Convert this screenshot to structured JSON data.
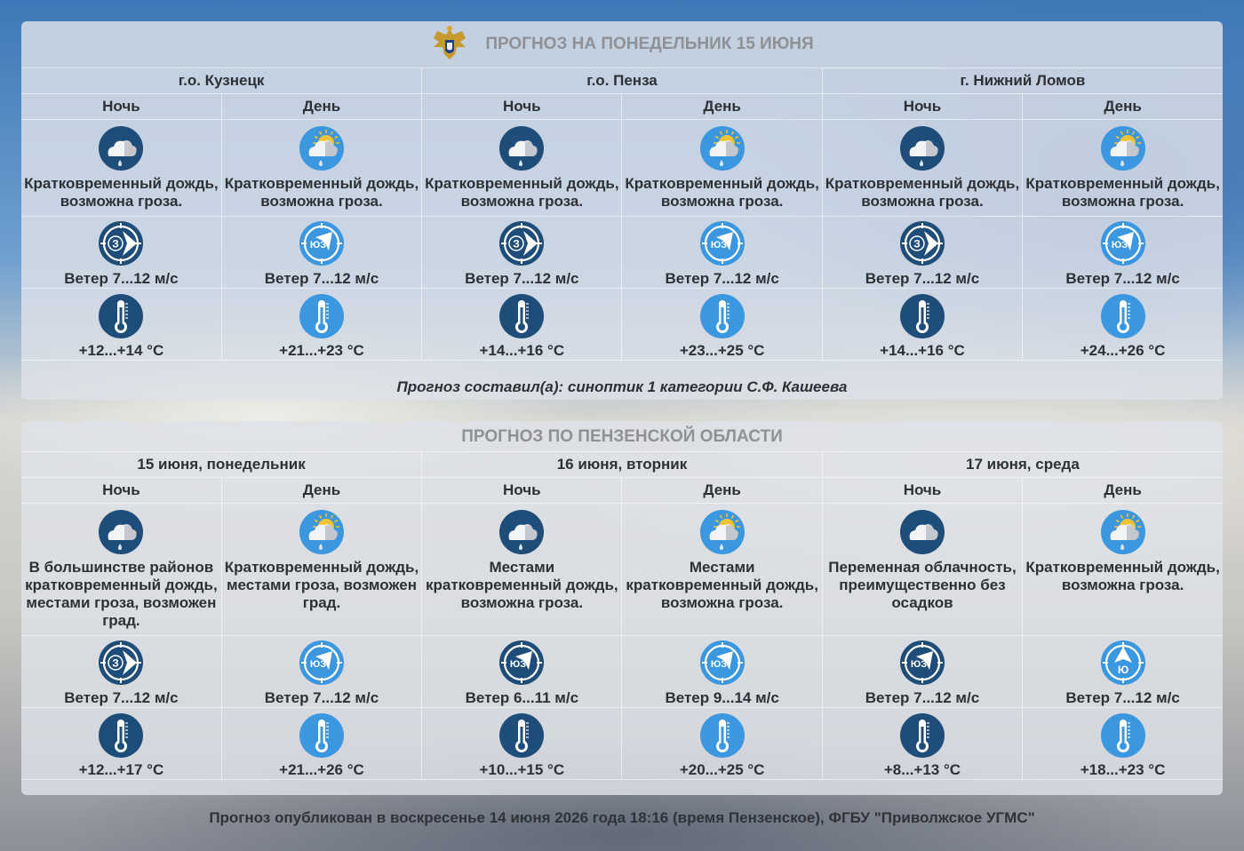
{
  "panel1": {
    "title": "ПРОГНОЗ НА ПОНЕДЕЛЬНИК 15 ИЮНЯ",
    "locations": [
      {
        "name": "г.о. Кузнецк",
        "periods": [
          {
            "label": "Ночь",
            "sky": "night-rain",
            "desc": "Кратковременный дождь, возможна гроза.",
            "wind_dir": "З",
            "wind": "Ветер 7...12 м/с",
            "temp": "+12...+14 °C",
            "temp_style": "night"
          },
          {
            "label": "День",
            "sky": "day-rain",
            "desc": "Кратковременный дождь, возможна гроза.",
            "wind_dir": "ЮЗ",
            "wind": "Ветер 7...12 м/с",
            "temp": "+21...+23 °C",
            "temp_style": "day"
          }
        ]
      },
      {
        "name": "г.о. Пенза",
        "periods": [
          {
            "label": "Ночь",
            "sky": "night-rain",
            "desc": "Кратковременный дождь, возможна гроза.",
            "wind_dir": "З",
            "wind": "Ветер 7...12 м/с",
            "temp": "+14...+16 °C",
            "temp_style": "night"
          },
          {
            "label": "День",
            "sky": "day-rain",
            "desc": "Кратковременный дождь, возможна гроза.",
            "wind_dir": "ЮЗ",
            "wind": "Ветер 7...12 м/с",
            "temp": "+23...+25 °C",
            "temp_style": "day"
          }
        ]
      },
      {
        "name": "г. Нижний Ломов",
        "periods": [
          {
            "label": "Ночь",
            "sky": "night-rain",
            "desc": "Кратковременный дождь, возможна гроза.",
            "wind_dir": "З",
            "wind": "Ветер 7...12 м/с",
            "temp": "+14...+16 °C",
            "temp_style": "night"
          },
          {
            "label": "День",
            "sky": "day-rain",
            "desc": "Кратковременный дождь, возможна гроза.",
            "wind_dir": "ЮЗ",
            "wind": "Ветер 7...12 м/с",
            "temp": "+24...+26 °C",
            "temp_style": "day"
          }
        ]
      }
    ],
    "author": "Прогноз составил(а): синоптик 1 категории С.Ф. Кашеева"
  },
  "panel2": {
    "title": "ПРОГНОЗ ПО ПЕНЗЕНСКОЙ ОБЛАСТИ",
    "locations": [
      {
        "name": "15 июня, понедельник",
        "periods": [
          {
            "label": "Ночь",
            "sky": "night-rain",
            "desc": "В большинстве районов кратковременный дождь, местами гроза, возможен град.",
            "wind_dir": "З",
            "wind": "Ветер 7...12 м/с",
            "temp": "+12...+17 °C",
            "temp_style": "night"
          },
          {
            "label": "День",
            "sky": "day-rain",
            "desc": "Кратковременный дождь, местами гроза, возможен град.",
            "wind_dir": "ЮЗ",
            "wind": "Ветер 7...12 м/с",
            "temp": "+21...+26 °C",
            "temp_style": "day"
          }
        ]
      },
      {
        "name": "16 июня, вторник",
        "periods": [
          {
            "label": "Ночь",
            "sky": "night-rain",
            "desc": "Местами кратковременный дождь, возможна гроза.",
            "wind_dir": "ЮЗ",
            "wind": "Ветер 6...11 м/с",
            "temp": "+10...+15 °C",
            "temp_style": "night"
          },
          {
            "label": "День",
            "sky": "day-rain",
            "desc": "Местами кратковременный дождь, возможна гроза.",
            "wind_dir": "ЮЗ",
            "wind": "Ветер 9...14 м/с",
            "temp": "+20...+25 °C",
            "temp_style": "day"
          }
        ]
      },
      {
        "name": "17 июня, среда",
        "periods": [
          {
            "label": "Ночь",
            "sky": "night-cloud",
            "desc": "Переменная облачность, преимущественно без осадков",
            "wind_dir": "ЮЗ",
            "wind": "Ветер 7...12 м/с",
            "temp": "+8...+13 °C",
            "temp_style": "night"
          },
          {
            "label": "День",
            "sky": "day-rain",
            "desc": "Кратковременный дождь, возможна гроза.",
            "wind_dir": "Ю",
            "wind": "Ветер 7...12 м/с",
            "temp": "+18...+23 °C",
            "temp_style": "day"
          }
        ]
      }
    ]
  },
  "footer": "Прогноз опубликован в воскресенье 14 июня 2026 года 18:16 (время Пензенское), ФГБУ \"Приволжское УГМС\"",
  "colors": {
    "night_icon": "#1f4d79",
    "day_icon": "#3a97e0",
    "sun": "#f1c232",
    "title": "#8f9196",
    "text": "#2d3136"
  }
}
